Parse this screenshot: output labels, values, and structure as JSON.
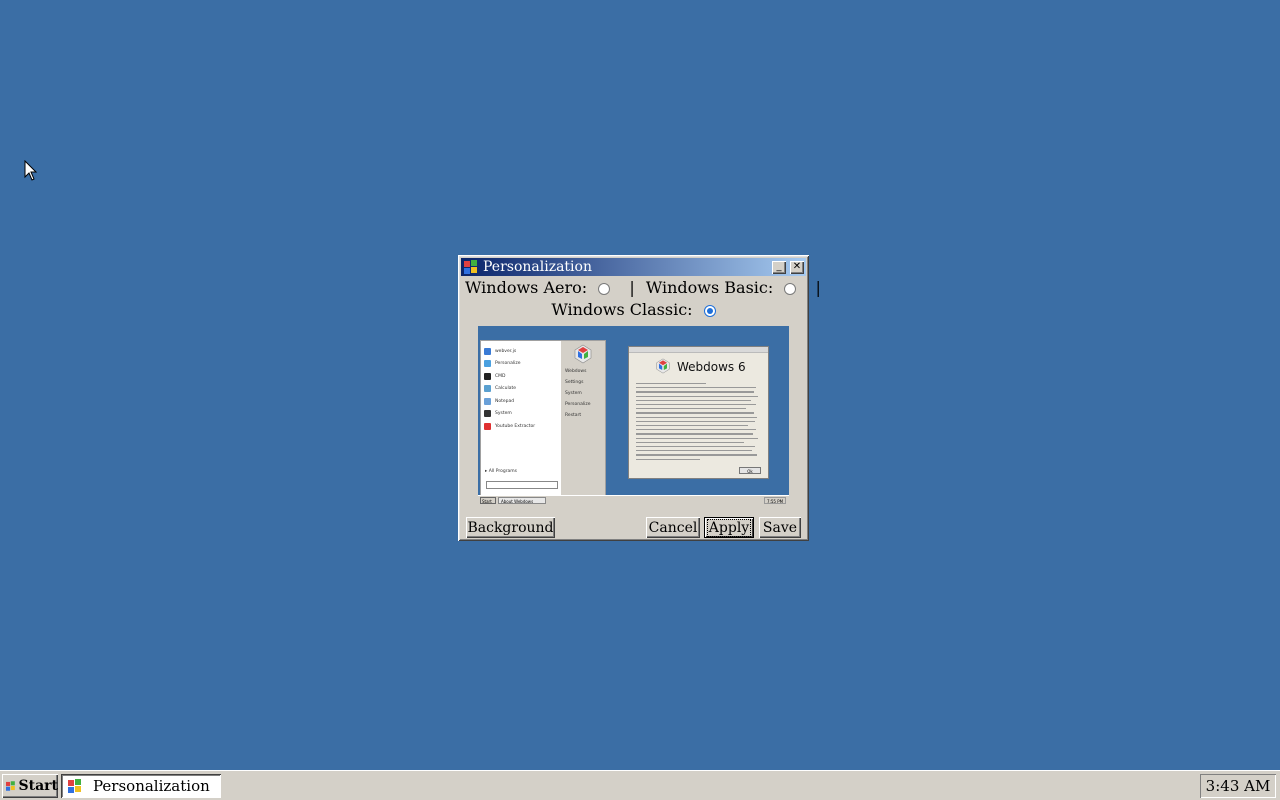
{
  "window": {
    "title": "Personalization",
    "minimize_glyph": "_",
    "close_glyph": "✕"
  },
  "themes": {
    "aero_label": "Windows Aero:",
    "basic_label": "Windows Basic:",
    "classic_label": "Windows Classic:",
    "separator": "|",
    "selected": "Windows Classic"
  },
  "preview": {
    "start_menu_left": [
      "webver.js",
      "Personalize",
      "CMD",
      "Calculate",
      "Notepad",
      "System",
      "Youtube Extractor"
    ],
    "start_menu_right": [
      "Webdows",
      "Settings",
      "System",
      "Personalize",
      "Restart"
    ],
    "all_programs": "▸ All Programs",
    "taskbar_start": "Start",
    "taskbar_task": "About Webdows",
    "taskbar_clock": "7:55 PM",
    "about_name": "Webdows 6",
    "about_ok": "Ok"
  },
  "buttons": {
    "background": "Background",
    "cancel": "Cancel",
    "apply": "Apply",
    "save": "Save"
  },
  "taskbar": {
    "start_label": "Start",
    "task_label": "Personalization",
    "clock": "3:43 AM"
  },
  "colors": {
    "desktop": "#3b6ea5",
    "titlebar_start": "#0a246a",
    "titlebar_end": "#a6caf0",
    "face": "#d4d0c8"
  }
}
